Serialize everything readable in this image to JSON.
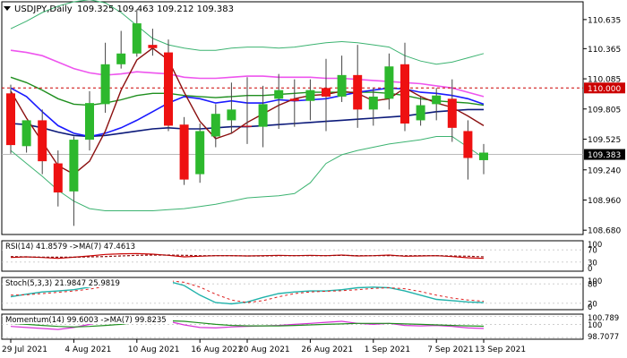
{
  "header": {
    "symbol_tf": "USDJPY,Daily",
    "ohlc": "109.325 109.463 109.212 109.383"
  },
  "colors": {
    "bull": "#2db82d",
    "bear": "#ee1111",
    "bb": "#3cb371",
    "ma_blue": "#1a1aff",
    "ma_navy": "#0c1a7a",
    "ma_green": "#1f8f1f",
    "ma_magenta": "#ee55ee",
    "ma_darkred": "#8b1010",
    "level_red": "#cc0000",
    "grid": "#c8c8c8"
  },
  "chart_data": [
    {
      "type": "candlestick",
      "title": "USDJPY,Daily",
      "price_ticks": [
        "110.635",
        "110.365",
        "110.085",
        "109.805",
        "109.525",
        "109.240",
        "108.960",
        "108.680"
      ],
      "ylim": [
        108.64,
        110.8
      ],
      "current_price": "109.383",
      "level_label": "110.000",
      "level_value": 110.0,
      "x_labels": [
        "29 Jul 2021",
        "4 Aug 2021",
        "10 Aug 2021",
        "16 Aug 2021",
        "20 Aug 2021",
        "26 Aug 2021",
        "1 Sep 2021",
        "7 Sep 2021",
        "13 Sep 2021"
      ],
      "candles": [
        {
          "o": 109.95,
          "h": 110.03,
          "l": 109.39,
          "c": 109.47
        },
        {
          "o": 109.46,
          "h": 109.65,
          "l": 109.4,
          "c": 109.7
        },
        {
          "o": 109.7,
          "h": 109.8,
          "l": 109.2,
          "c": 109.32
        },
        {
          "o": 109.3,
          "h": 109.42,
          "l": 108.9,
          "c": 109.03
        },
        {
          "o": 109.04,
          "h": 109.55,
          "l": 108.72,
          "c": 109.52
        },
        {
          "o": 109.52,
          "h": 109.97,
          "l": 109.42,
          "c": 109.86
        },
        {
          "o": 109.85,
          "h": 110.42,
          "l": 109.77,
          "c": 110.22
        },
        {
          "o": 110.22,
          "h": 110.53,
          "l": 110.18,
          "c": 110.32
        },
        {
          "o": 110.32,
          "h": 110.73,
          "l": 110.29,
          "c": 110.6
        },
        {
          "o": 110.4,
          "h": 110.55,
          "l": 110.3,
          "c": 110.37
        },
        {
          "o": 110.33,
          "h": 110.45,
          "l": 109.6,
          "c": 109.65
        },
        {
          "o": 109.66,
          "h": 109.73,
          "l": 109.1,
          "c": 109.15
        },
        {
          "o": 109.2,
          "h": 109.67,
          "l": 109.12,
          "c": 109.6
        },
        {
          "o": 109.55,
          "h": 109.85,
          "l": 109.45,
          "c": 109.76
        },
        {
          "o": 109.7,
          "h": 110.05,
          "l": 109.58,
          "c": 109.8
        },
        {
          "o": 109.65,
          "h": 110.1,
          "l": 109.48,
          "c": 109.64
        },
        {
          "o": 109.64,
          "h": 110.02,
          "l": 109.45,
          "c": 109.85
        },
        {
          "o": 109.9,
          "h": 110.13,
          "l": 109.62,
          "c": 109.98
        },
        {
          "o": 109.9,
          "h": 110.08,
          "l": 109.64,
          "c": 109.88
        },
        {
          "o": 109.88,
          "h": 110.08,
          "l": 109.7,
          "c": 109.98
        },
        {
          "o": 110.0,
          "h": 110.27,
          "l": 109.6,
          "c": 109.92
        },
        {
          "o": 109.92,
          "h": 110.3,
          "l": 109.87,
          "c": 110.12
        },
        {
          "o": 110.12,
          "h": 110.4,
          "l": 109.63,
          "c": 109.8
        },
        {
          "o": 109.8,
          "h": 110.0,
          "l": 109.65,
          "c": 109.92
        },
        {
          "o": 109.9,
          "h": 110.32,
          "l": 109.8,
          "c": 110.2
        },
        {
          "o": 110.22,
          "h": 110.42,
          "l": 109.6,
          "c": 109.67
        },
        {
          "o": 109.7,
          "h": 109.92,
          "l": 109.65,
          "c": 109.84
        },
        {
          "o": 109.85,
          "h": 110.0,
          "l": 109.7,
          "c": 109.93
        },
        {
          "o": 109.9,
          "h": 110.08,
          "l": 109.5,
          "c": 109.63
        },
        {
          "o": 109.6,
          "h": 109.7,
          "l": 109.15,
          "c": 109.35
        },
        {
          "o": 109.33,
          "h": 109.48,
          "l": 109.2,
          "c": 109.4
        }
      ],
      "bb_upper": [
        110.55,
        110.62,
        110.7,
        110.76,
        110.8,
        110.82,
        110.79,
        110.7,
        110.58,
        110.46,
        110.4,
        110.37,
        110.35,
        110.35,
        110.37,
        110.38,
        110.38,
        110.37,
        110.38,
        110.4,
        110.42,
        110.43,
        110.42,
        110.4,
        110.38,
        110.3,
        110.25,
        110.22,
        110.24,
        110.28,
        110.32
      ],
      "bb_lower": [
        109.42,
        109.3,
        109.18,
        109.05,
        108.95,
        108.88,
        108.86,
        108.86,
        108.86,
        108.86,
        108.87,
        108.88,
        108.9,
        108.92,
        108.95,
        108.98,
        108.99,
        109.0,
        109.02,
        109.12,
        109.3,
        109.38,
        109.42,
        109.45,
        109.48,
        109.5,
        109.52,
        109.55,
        109.55,
        109.45,
        109.35
      ],
      "ma_blue": [
        110.0,
        109.92,
        109.78,
        109.65,
        109.58,
        109.55,
        109.58,
        109.63,
        109.7,
        109.78,
        109.86,
        109.92,
        109.9,
        109.86,
        109.88,
        109.86,
        109.86,
        109.89,
        109.88,
        109.89,
        109.9,
        109.93,
        109.96,
        109.98,
        110.0,
        109.99,
        109.96,
        109.95,
        109.93,
        109.9,
        109.85
      ],
      "ma_navy": [
        109.67,
        109.66,
        109.63,
        109.59,
        109.56,
        109.55,
        109.56,
        109.58,
        109.6,
        109.62,
        109.63,
        109.62,
        109.62,
        109.63,
        109.64,
        109.64,
        109.65,
        109.66,
        109.67,
        109.68,
        109.69,
        109.7,
        109.71,
        109.72,
        109.73,
        109.74,
        109.76,
        109.78,
        109.79,
        109.8,
        109.8
      ],
      "ma_green": [
        110.1,
        110.05,
        109.98,
        109.9,
        109.85,
        109.84,
        109.86,
        109.89,
        109.93,
        109.95,
        109.95,
        109.93,
        109.92,
        109.91,
        109.92,
        109.93,
        109.93,
        109.94,
        109.95,
        109.96,
        109.96,
        109.96,
        109.96,
        109.96,
        109.95,
        109.93,
        109.9,
        109.88,
        109.87,
        109.86,
        109.84
      ],
      "ma_magenta": [
        110.35,
        110.33,
        110.3,
        110.24,
        110.18,
        110.14,
        110.12,
        110.13,
        110.15,
        110.14,
        110.13,
        110.1,
        110.09,
        110.09,
        110.1,
        110.11,
        110.11,
        110.1,
        110.1,
        110.1,
        110.09,
        110.09,
        110.08,
        110.07,
        110.06,
        110.05,
        110.04,
        110.02,
        110.0,
        109.96,
        109.92
      ],
      "ma_darkred": [
        109.97,
        109.72,
        109.5,
        109.28,
        109.2,
        109.32,
        109.6,
        109.98,
        110.26,
        110.37,
        110.26,
        109.96,
        109.69,
        109.53,
        109.58,
        109.68,
        109.76,
        109.84,
        109.9,
        109.93,
        109.94,
        109.97,
        109.95,
        109.88,
        109.9,
        110.0,
        109.92,
        109.86,
        109.82,
        109.74,
        109.65
      ]
    },
    {
      "type": "line",
      "title": "RSI(14) 41.8579 ->MA(7) 47.4613",
      "levels": [
        "100",
        "70",
        "30",
        "0"
      ],
      "ylim": [
        0,
        100
      ],
      "series": [
        {
          "values": [
            45,
            47,
            45,
            42,
            46,
            50,
            55,
            57,
            58,
            56,
            52,
            47,
            49,
            51,
            51,
            50,
            51,
            52,
            51,
            52,
            51,
            53,
            50,
            51,
            53,
            49,
            50,
            51,
            48,
            44,
            42
          ]
        },
        {
          "values": [
            48,
            47,
            46,
            46,
            46,
            47,
            48,
            50,
            52,
            53,
            53,
            52,
            51,
            51,
            51,
            50,
            50,
            51,
            51,
            51,
            51,
            52,
            51,
            51,
            51,
            51,
            51,
            51,
            50,
            49,
            47
          ]
        }
      ]
    },
    {
      "type": "line",
      "title": "Stoch(5,3,3) 21.9847 25.9819",
      "levels": [
        "100",
        "80",
        "20",
        "0"
      ],
      "ylim": [
        0,
        100
      ],
      "series": [
        {
          "values": [
            40,
            48,
            55,
            58,
            62,
            70,
            80,
            88,
            92,
            92,
            88,
            75,
            45,
            22,
            18,
            24,
            38,
            50,
            55,
            58,
            58,
            62,
            68,
            70,
            68,
            58,
            45,
            32,
            28,
            24,
            22
          ]
        },
        {
          "values": [
            45,
            46,
            50,
            54,
            58,
            64,
            72,
            80,
            86,
            90,
            90,
            85,
            70,
            48,
            30,
            22,
            28,
            40,
            50,
            55,
            57,
            59,
            62,
            66,
            68,
            65,
            56,
            45,
            36,
            30,
            26
          ]
        }
      ]
    },
    {
      "type": "line",
      "title": "Momentum(14) 99.6003 ->MA(7) 99.8235",
      "levels": [
        "100.789",
        "100",
        "98.7077"
      ],
      "ylim": [
        98.55,
        101.0
      ],
      "series": [
        {
          "values": [
            99.8,
            99.7,
            99.6,
            99.5,
            99.7,
            100.0,
            100.3,
            100.6,
            100.75,
            100.6,
            100.3,
            99.95,
            99.7,
            99.65,
            99.75,
            99.8,
            99.85,
            99.9,
            100.0,
            100.1,
            100.2,
            100.3,
            100.1,
            100.0,
            100.1,
            99.9,
            99.85,
            99.9,
            99.8,
            99.65,
            99.6
          ]
        },
        {
          "values": [
            100.1,
            100.0,
            99.9,
            99.8,
            99.75,
            99.8,
            99.9,
            100.0,
            100.2,
            100.3,
            100.35,
            100.3,
            100.15,
            100.0,
            99.9,
            99.85,
            99.85,
            99.85,
            99.9,
            99.95,
            100.0,
            100.05,
            100.1,
            100.1,
            100.1,
            100.05,
            100.0,
            99.95,
            99.9,
            99.85,
            99.82
          ]
        }
      ]
    }
  ]
}
